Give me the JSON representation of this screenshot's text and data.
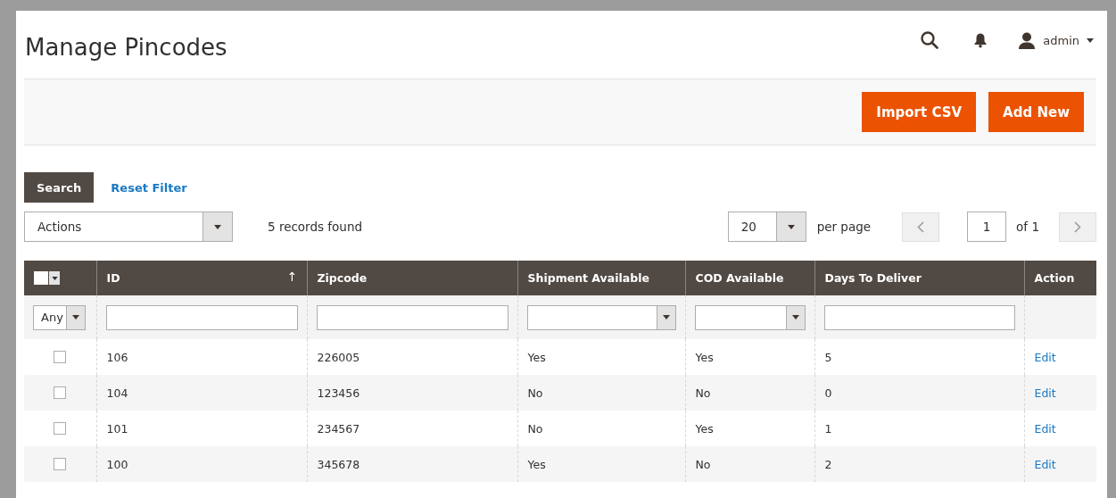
{
  "page_title": "Manage Pincodes",
  "user_menu": {
    "name": "admin"
  },
  "action_buttons": [
    "Import CSV",
    "Add New"
  ],
  "filter_controls": {
    "search": "Search",
    "reset": "Reset Filter"
  },
  "mass_actions": {
    "value": "Actions"
  },
  "records_found": "5 records found",
  "pagination": {
    "per_page_value": "20",
    "per_page_label": "per page",
    "page": "1",
    "of_pages": "of 1"
  },
  "table": {
    "mass_select": {
      "checked": false
    },
    "columns": [
      {
        "label": "ID",
        "sort_indicator": "↑"
      },
      {
        "label": "Zipcode"
      },
      {
        "label": "Shipment Available"
      },
      {
        "label": "COD Available"
      },
      {
        "label": "Days To Deliver"
      },
      {
        "label": "Action"
      }
    ],
    "filters": [
      {
        "kind": "select",
        "value": "Any"
      },
      {
        "kind": "text"
      },
      {
        "kind": "text"
      },
      {
        "kind": "select"
      },
      {
        "kind": "select"
      },
      {
        "kind": "text"
      },
      {
        "kind": "none"
      }
    ],
    "rows": [
      {
        "checked": false,
        "cells": [
          "106",
          "226005",
          "Yes",
          "Yes",
          "5"
        ],
        "action": "Edit"
      },
      {
        "checked": false,
        "cells": [
          "104",
          "123456",
          "No",
          "No",
          "0"
        ],
        "action": "Edit"
      },
      {
        "checked": false,
        "cells": [
          "101",
          "234567",
          "No",
          "Yes",
          "1"
        ],
        "action": "Edit"
      },
      {
        "checked": false,
        "cells": [
          "100",
          "345678",
          "Yes",
          "No",
          "2"
        ],
        "action": "Edit"
      }
    ]
  }
}
